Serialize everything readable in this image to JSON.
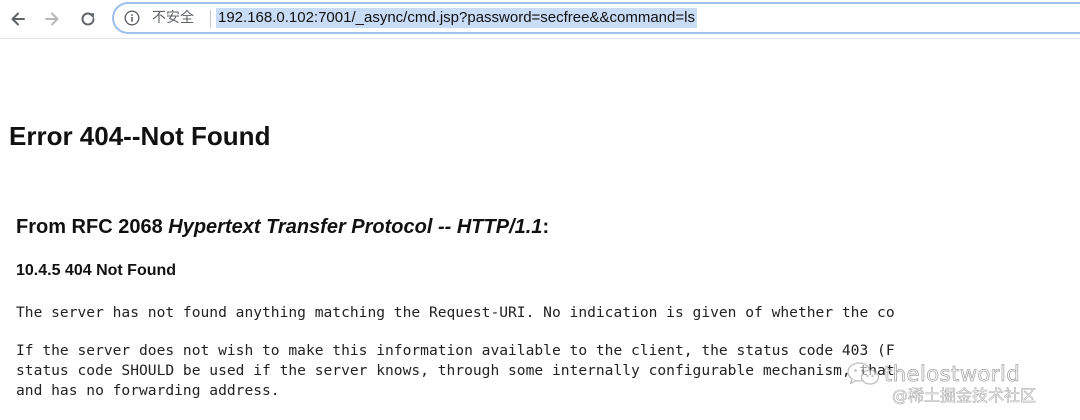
{
  "browser": {
    "security_label": "不安全",
    "url": "192.168.0.102:7001/_async/cmd.jsp?password=secfree&&command=ls",
    "icons": {
      "back": "back-arrow-icon",
      "forward": "forward-arrow-icon",
      "reload": "reload-icon",
      "info": "info-icon"
    }
  },
  "page": {
    "title": "Error 404--Not Found",
    "rfc_heading_prefix": "From RFC 2068 ",
    "rfc_heading_italic": "Hypertext Transfer Protocol -- HTTP/1.1",
    "rfc_heading_suffix": ":",
    "section_heading": "10.4.5 404 Not Found",
    "paragraph1": "The server has not found anything matching the Request-URI. No indication is given of whether the co",
    "paragraph2_line1": "If the server does not wish to make this information available to the client, the status code 403 (F",
    "paragraph2_line2": "status code SHOULD be used if the server knows, through some internally configurable mechanism, that",
    "paragraph2_line3": "and has no forwarding address."
  },
  "watermark": {
    "logo": "wechat-logo",
    "name": "thelostworld",
    "credit": "@稀土掘金技术社区"
  }
}
